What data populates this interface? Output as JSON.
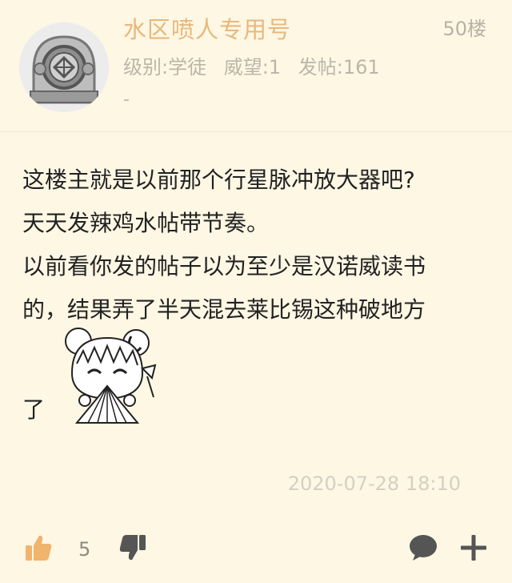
{
  "post": {
    "username": "水区喷人专用号",
    "floor": "50楼",
    "stats": {
      "level": "级别:学徒",
      "prestige": "威望:1",
      "posts": "发帖:161"
    },
    "signature": "-",
    "content_lines": [
      "这楼主就是以前那个行星脉冲放大器吧?",
      "天天发辣鸡水帖带节奏。",
      "以前看你发的帖子以为至少是汉诺威读书",
      "的，结果弄了半天混去莱比锡这种破地方"
    ],
    "sticker_trailing_text": "了",
    "timestamp": "2020-07-28 18:10",
    "like_count": "5",
    "icons": {
      "avatar": "diving-helmet-avatar",
      "sticker": "anime-girl-fan-sticker",
      "like": "thumbs-up-icon",
      "dislike": "thumbs-down-icon",
      "comment": "comment-bubble-icon",
      "more": "plus-icon"
    },
    "colors": {
      "background": "#fdf7e4",
      "username": "#e8b87c",
      "like_icon": "#f0b46c",
      "muted_text": "#bdb6a8"
    }
  }
}
